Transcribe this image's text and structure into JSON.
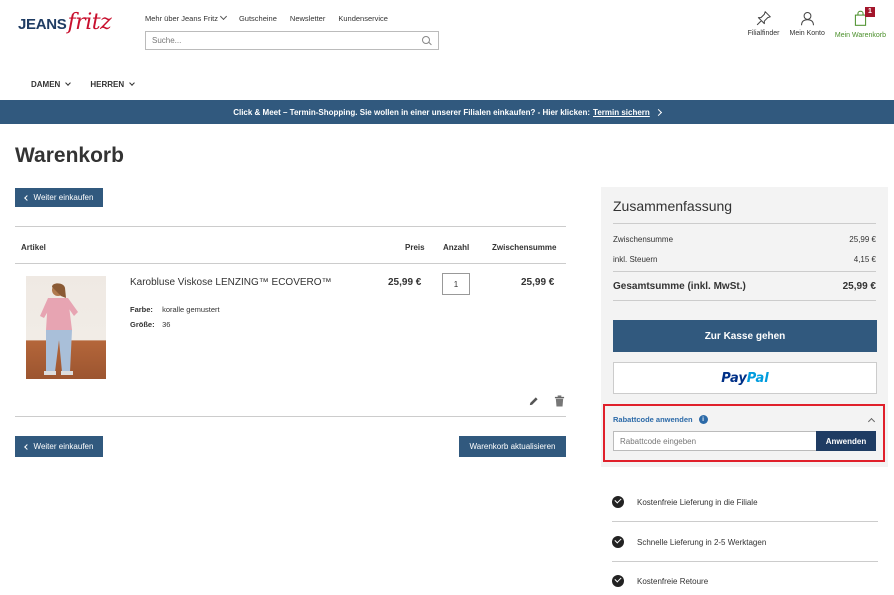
{
  "header": {
    "logo_jeans": "JEANS",
    "logo_fritz": "fritz",
    "topnav": [
      "Mehr über Jeans Fritz",
      "Gutscheine",
      "Newsletter",
      "Kundenservice"
    ],
    "search_placeholder": "Suche...",
    "filialfinder": "Filialfinder",
    "mein_konto": "Mein Konto",
    "mein_warenkorb": "Mein Warenkorb",
    "cart_count": "1"
  },
  "catnav": [
    "DAMEN",
    "HERREN"
  ],
  "banner": {
    "text": "Click & Meet – Termin-Shopping. Sie wollen in einer unserer Filialen einkaufen? - Hier klicken:",
    "link": "Termin sichern"
  },
  "page_title": "Warenkorb",
  "buttons": {
    "weiter_einkaufen": "Weiter einkaufen",
    "update": "Warenkorb aktualisieren"
  },
  "table": {
    "headers": {
      "artikel": "Artikel",
      "preis": "Preis",
      "anzahl": "Anzahl",
      "zwischensumme": "Zwischensumme"
    }
  },
  "item": {
    "name": "Karobluse Viskose LENZING™ ECOVERO™",
    "farbe_label": "Farbe:",
    "farbe": "koralle gemustert",
    "groesse_label": "Größe:",
    "groesse": "36",
    "price": "25,99 €",
    "qty": "1",
    "subtotal": "25,99 €"
  },
  "summary": {
    "title": "Zusammenfassung",
    "zwischensumme_label": "Zwischensumme",
    "zwischensumme": "25,99 €",
    "steuern_label": "inkl. Steuern",
    "steuern": "4,15 €",
    "total_label": "Gesamtsumme (inkl. MwSt.)",
    "total": "25,99 €",
    "checkout": "Zur Kasse gehen",
    "paypal_pay": "Pay",
    "paypal_pal": "Pal"
  },
  "rabatt": {
    "label": "Rabattcode anwenden",
    "info": "i",
    "placeholder": "Rabattcode eingeben",
    "apply": "Anwenden"
  },
  "usps": [
    "Kostenfreie Lieferung in die Filiale",
    "Schnelle Lieferung in 2-5 Werktagen",
    "Kostenfreie Retoure"
  ],
  "colors": {
    "primary": "#31597e",
    "dark_button": "#1f3c63",
    "highlight": "#e0202b",
    "brand_red": "#c8102e",
    "cart_green": "#4a8f2a"
  }
}
